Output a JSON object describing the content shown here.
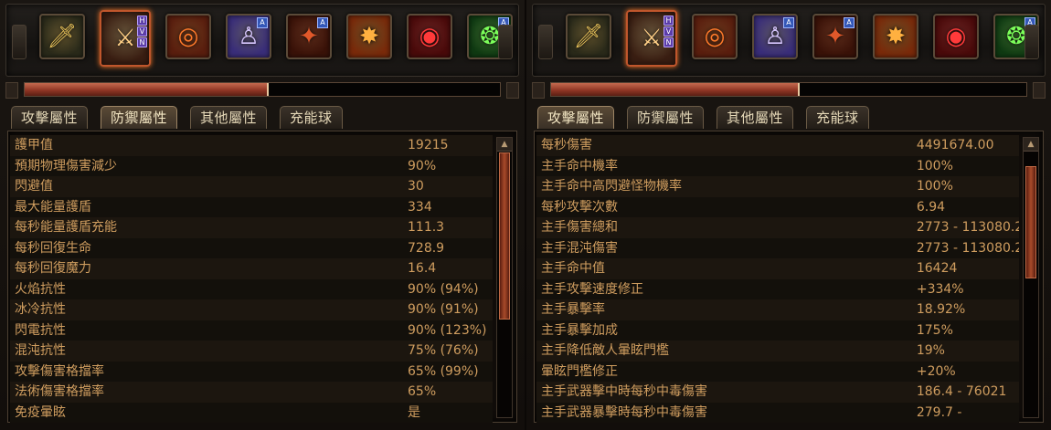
{
  "left_panel": {
    "resource_fill": 0.51,
    "tabs": [
      {
        "label": "攻擊屬性",
        "selected": false
      },
      {
        "label": "防禦屬性",
        "selected": true
      },
      {
        "label": "其他屬性",
        "selected": false
      },
      {
        "label": "充能球",
        "selected": false
      }
    ],
    "stats": [
      {
        "name": "護甲值",
        "value": "19215"
      },
      {
        "name": "預期物理傷害減少",
        "value": "90%"
      },
      {
        "name": "閃避值",
        "value": "30"
      },
      {
        "name": "最大能量護盾",
        "value": "334"
      },
      {
        "name": "每秒能量護盾充能",
        "value": "111.3"
      },
      {
        "name": "每秒回復生命",
        "value": "728.9"
      },
      {
        "name": "每秒回復魔力",
        "value": "16.4"
      },
      {
        "name": "火焰抗性",
        "value": "90% (94%)"
      },
      {
        "name": "冰冷抗性",
        "value": "90% (91%)"
      },
      {
        "name": "閃電抗性",
        "value": "90% (123%)"
      },
      {
        "name": "混沌抗性",
        "value": "75% (76%)"
      },
      {
        "name": "攻擊傷害格擋率",
        "value": "65% (99%)"
      },
      {
        "name": "法術傷害格擋率",
        "value": "65%"
      },
      {
        "name": "免疫暈眩",
        "value": "是"
      }
    ],
    "scroll_position": 0.0,
    "scroll_visible_fraction": 0.6
  },
  "right_panel": {
    "resource_fill": 0.52,
    "tabs": [
      {
        "label": "攻擊屬性",
        "selected": true
      },
      {
        "label": "防禦屬性",
        "selected": false
      },
      {
        "label": "其他屬性",
        "selected": false
      },
      {
        "label": "充能球",
        "selected": false
      }
    ],
    "stats": [
      {
        "name": "每秒傷害",
        "value": "4491674.00"
      },
      {
        "name": "主手命中機率",
        "value": "100%"
      },
      {
        "name": "主手命中高閃避怪物機率",
        "value": "100%"
      },
      {
        "name": "每秒攻擊次數",
        "value": "6.94"
      },
      {
        "name": "主手傷害總和",
        "value": "2773 - 113080.2"
      },
      {
        "name": "主手混沌傷害",
        "value": "2773 - 113080.2"
      },
      {
        "name": "主手命中值",
        "value": "16424"
      },
      {
        "name": "主手攻擊速度修正",
        "value": "+334%"
      },
      {
        "name": "主手暴擊率",
        "value": "18.92%"
      },
      {
        "name": "主手暴擊加成",
        "value": "175%"
      },
      {
        "name": "主手降低敵人暈眩門檻",
        "value": "19%"
      },
      {
        "name": "暈眩門檻修正",
        "value": "+20%"
      },
      {
        "name": "主手武器擊中時每秒中毒傷害",
        "value": "186.4 - 76021"
      },
      {
        "name": "主手武器暴擊時每秒中毒傷害",
        "value": "279.7 -"
      }
    ],
    "scroll_position": 0.05,
    "scroll_visible_fraction": 0.4
  },
  "skill_icons": [
    {
      "icon": "sword-icon",
      "glyph": "🗡",
      "bg": "#2a2a1a",
      "color": "#e8c25a",
      "active": false,
      "marker": ""
    },
    {
      "icon": "sword-slash-icon",
      "glyph": "⚔",
      "bg": "#3a1e12",
      "color": "#ffcf86",
      "active": true,
      "marker": "runes"
    },
    {
      "icon": "fire-ring-icon",
      "glyph": "◎",
      "bg": "#5a1e0e",
      "color": "#ff7a2a",
      "active": false,
      "marker": ""
    },
    {
      "icon": "spirit-figure-icon",
      "glyph": "♙",
      "bg": "#3a2e7a",
      "color": "#d8c7ff",
      "active": false,
      "marker": "badge"
    },
    {
      "icon": "dark-warrior-icon",
      "glyph": "✦",
      "bg": "#3a1208",
      "color": "#e0582a",
      "active": false,
      "marker": "badge"
    },
    {
      "icon": "leap-slam-icon",
      "glyph": "✸",
      "bg": "#7a2a0a",
      "color": "#ffb040",
      "active": false,
      "marker": ""
    },
    {
      "icon": "vortex-icon",
      "glyph": "◉",
      "bg": "#4a0a0a",
      "color": "#ff3a3a",
      "active": false,
      "marker": ""
    },
    {
      "icon": "plague-warrior-icon",
      "glyph": "❂",
      "bg": "#0f3a12",
      "color": "#7cff5a",
      "active": false,
      "marker": "badge"
    }
  ],
  "rune_letters": [
    "H",
    "V",
    "N"
  ],
  "badge_letter": "A"
}
